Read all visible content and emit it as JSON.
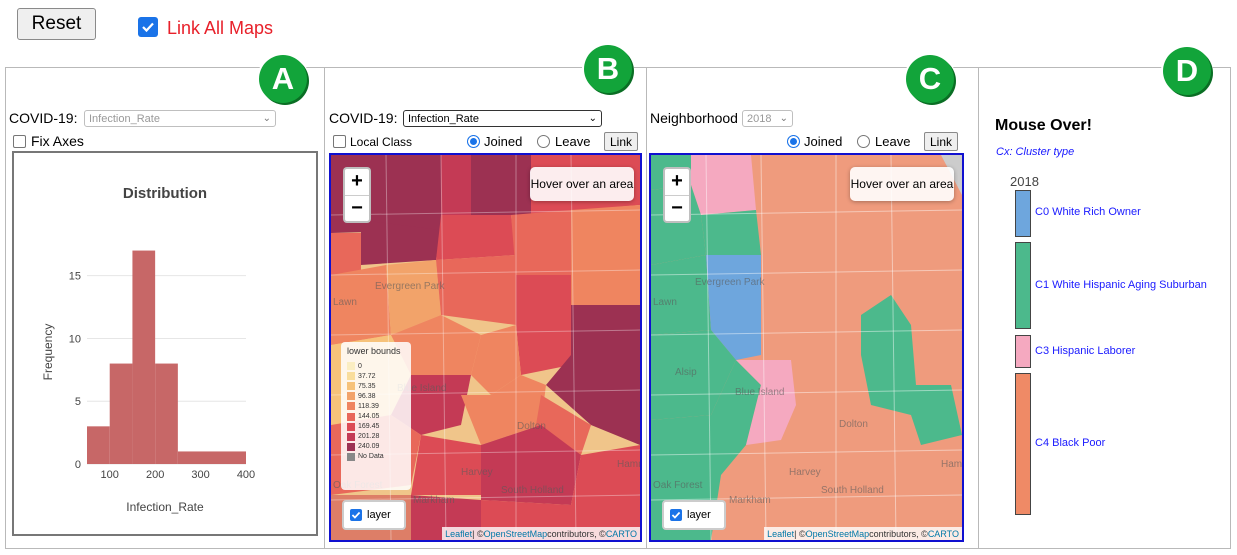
{
  "toolbar": {
    "reset_label": "Reset",
    "link_all_label": "Link All Maps",
    "link_all_checked": true
  },
  "panels": {
    "a": {
      "badge": "A",
      "variable_label": "COVID-19:",
      "variable_select": "Infection_Rate",
      "fix_axes_label": "Fix Axes"
    },
    "b": {
      "badge": "B",
      "variable_label": "COVID-19:",
      "variable_select": "Infection_Rate",
      "local_class_label": "Local Class",
      "joined_label": "Joined",
      "leave_label": "Leave",
      "link_button": "Link",
      "zoom_in": "+",
      "zoom_out": "−",
      "hover_hint": "Hover over an area",
      "layer_label": "layer",
      "legend_title": "lower bounds",
      "legend_items": [
        "0",
        "37.72",
        "75.35",
        "96.38",
        "118.39",
        "144.05",
        "169.45",
        "201.28",
        "240.09",
        "No Data"
      ],
      "legend_colors": [
        "#fbeec2",
        "#f9dd9c",
        "#f6c27a",
        "#f2a36a",
        "#ef8560",
        "#e8685a",
        "#dc4b55",
        "#c43a55",
        "#9c3152",
        "#888888"
      ],
      "town_labels": [
        "Evergreen Park",
        "Blue Island",
        "Dolton",
        "Harvey",
        "South Holland",
        "Markham",
        "Oak Forest",
        "Lawn",
        "Hamm"
      ],
      "attribution_leaflet": "Leaflet",
      "attribution_osm": "OpenStreetMap",
      "attribution_mid": " | © ",
      "attribution_tail": " contributors, © ",
      "attribution_carto": "CARTO"
    },
    "c": {
      "badge": "C",
      "variable_label": "Neighborhood",
      "year_select": "2018",
      "joined_label": "Joined",
      "leave_label": "Leave",
      "link_button": "Link",
      "zoom_in": "+",
      "zoom_out": "−",
      "hover_hint": "Hover over an area",
      "layer_label": "layer",
      "town_labels": [
        "Evergreen Park",
        "Alsip",
        "Blue Island",
        "Dolton",
        "Harvey",
        "South Holland",
        "Markham",
        "Oak Forest",
        "Lawn",
        "Hamm"
      ],
      "attribution_leaflet": "Leaflet",
      "attribution_osm": "OpenStreetMap",
      "attribution_mid": " | © ",
      "attribution_tail": " contributors, © ",
      "attribution_carto": "CARTO"
    },
    "d": {
      "badge": "D",
      "title": "Mouse Over!",
      "subtitle": "Cx: Cluster type",
      "year": "2018",
      "clusters": [
        {
          "label": "C0 White Rich Owner",
          "color": "#6ea6dd"
        },
        {
          "label": "C1 White Hispanic Aging Suburban",
          "color": "#4cb98c"
        },
        {
          "label": "C3 Hispanic Laborer",
          "color": "#f5a9c0"
        },
        {
          "label": "C4 Black Poor",
          "color": "#ef8a66"
        }
      ]
    }
  },
  "chart_data": {
    "type": "bar",
    "title": "Distribution",
    "xlabel": "Infection_Rate",
    "ylabel": "Frequency",
    "bin_edges": [
      50,
      100,
      150,
      200,
      250,
      400
    ],
    "values": [
      3,
      8,
      17,
      8,
      1
    ],
    "xticks": [
      100,
      200,
      300,
      400
    ],
    "yticks": [
      0,
      5,
      10,
      15
    ],
    "xlim": [
      50,
      400
    ],
    "ylim": [
      0,
      18
    ],
    "bar_color": "#c76767",
    "grid": true
  },
  "colors": {
    "badge_green": "#12a43a",
    "map_border": "#1010d0",
    "link_all_red": "#e8202a",
    "cluster_link_blue": "#1a1aff"
  }
}
